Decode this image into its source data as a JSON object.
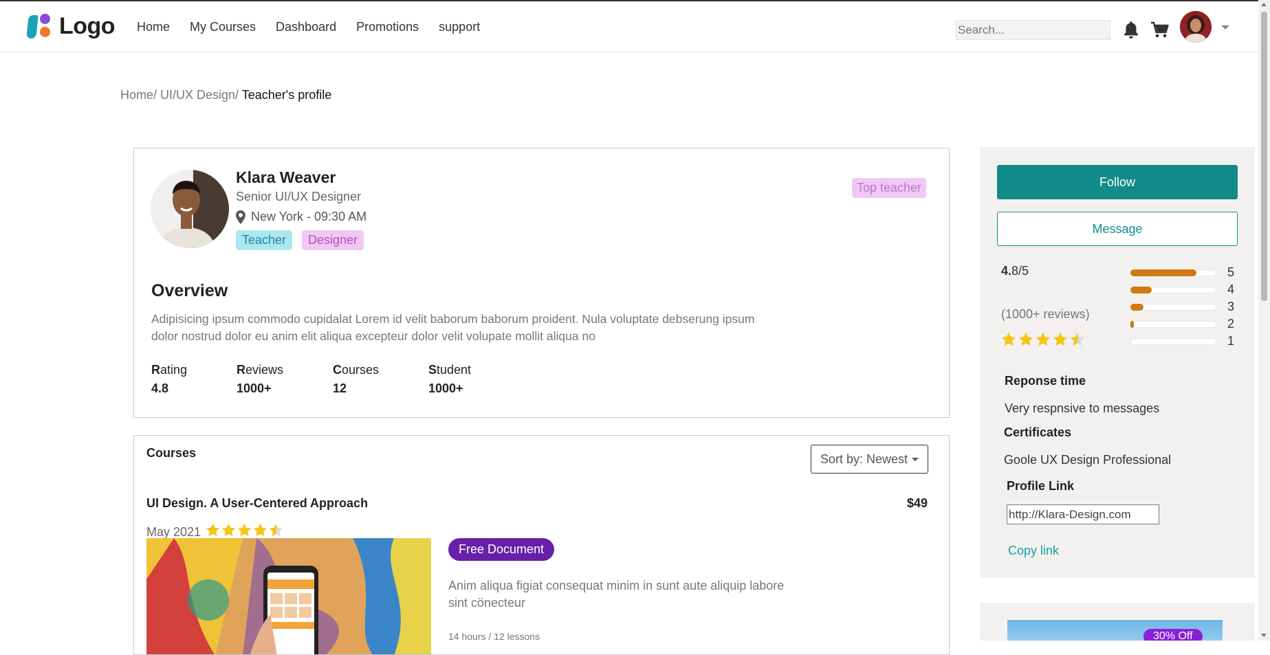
{
  "header": {
    "logo_text": "Logo",
    "nav": [
      "Home",
      "My Courses",
      "Dashboard",
      "Promotions",
      "support"
    ],
    "search_placeholder": "Search...",
    "icons": [
      "bell-icon",
      "cart-icon",
      "chevron-down-icon"
    ]
  },
  "breadcrumb": {
    "items": [
      "Home/",
      "UI/UX Design/"
    ],
    "current": "Teacher's profile"
  },
  "profile": {
    "name": "Klara Weaver",
    "title": "Senior UI/UX Designer",
    "location": "New York - 09:30 AM",
    "tags": [
      "Teacher",
      "Designer"
    ],
    "badge": "Top teacher",
    "overview_heading": "Overview",
    "overview_text": "Adipisicing ipsum commodo cupidalat Lorem id velit baborum baborum proident. Nula voluptate debserung ipsum dolor nostrud dolor eu anim elit aliqua excepteur dolor velit volupate mollit aliqua no",
    "stats": [
      {
        "initial": "R",
        "rest": "ating",
        "value": "4.8"
      },
      {
        "initial": "R",
        "rest": "eviews",
        "value": "1000+"
      },
      {
        "initial": "C",
        "rest": "ourses",
        "value": "12"
      },
      {
        "initial": "S",
        "rest": "tudent",
        "value": "1000+"
      }
    ]
  },
  "courses": {
    "heading": "Courses",
    "sort_label": "Sort by: Newest",
    "items": [
      {
        "title": "UI Design. A User-Centered Approach",
        "price": "$49",
        "date": "May 2021",
        "rating_stars": 4.5,
        "badge": "Free Document",
        "description": "Anim aliqua figiat consequat minim in sunt aute aliquip labore sint cönecteur",
        "meta": "14 hours / 12 lessons"
      }
    ]
  },
  "sidebar": {
    "follow_label": "Follow",
    "message_label": "Message",
    "score_bold": "4.",
    "score_rest": "8/5",
    "reviews": "(1000+ reviews)",
    "rating_stars": 4.5,
    "distribution": [
      {
        "label": "5",
        "fraction": 0.77
      },
      {
        "label": "4",
        "fraction": 0.25
      },
      {
        "label": "3",
        "fraction": 0.15
      },
      {
        "label": "2",
        "fraction": 0.04
      },
      {
        "label": "1",
        "fraction": 0
      }
    ],
    "response_heading": "Reponse time",
    "response_text": "Very respnsive to messages",
    "certificates_heading": "Certificates",
    "certificate": "Goole UX Design Professional",
    "profile_link_heading": "Profile Link",
    "profile_link_value": "http://Klara-Design.com",
    "copy_label": "Copy link"
  },
  "promo": {
    "badge": "30% Off"
  },
  "colors": {
    "primary": "#118a8a",
    "star": "#f5c518",
    "bar": "#cf7a10",
    "free_doc": "#6a1fa8"
  }
}
